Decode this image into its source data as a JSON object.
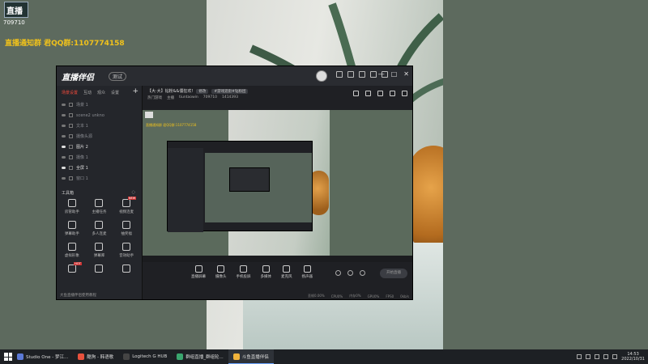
{
  "overlay": {
    "logo_text": "直播",
    "room_id": "709710",
    "notice": "直播通知群 君QQ群:1107774158"
  },
  "app": {
    "brand": "直播伴侣",
    "badge": "测试",
    "window_buttons": [
      "—",
      "□",
      "✕"
    ],
    "left": {
      "tabs": [
        "场景设置",
        "互动",
        "观众",
        "设置"
      ],
      "add_label": "+",
      "scenes": [
        {
          "label": "场景 1",
          "on": false
        },
        {
          "label": "scene2 unkno",
          "on": false
        },
        {
          "label": "文本 1",
          "on": false
        },
        {
          "label": "摄像头源",
          "on": false
        },
        {
          "label": "图片 2",
          "on": true
        },
        {
          "label": "摄像 1",
          "on": false
        },
        {
          "label": "全屏 1",
          "on": true
        },
        {
          "label": "窗口 1",
          "on": false
        }
      ],
      "toolbox_title": "工具箱",
      "tools": [
        {
          "label": "房管助手",
          "hot": ""
        },
        {
          "label": "主播任务",
          "hot": ""
        },
        {
          "label": "视频连麦",
          "hot": "NEW"
        },
        {
          "label": "弹幕助手",
          "hot": ""
        },
        {
          "label": "多人连麦",
          "hot": ""
        },
        {
          "label": "抽奖福",
          "hot": ""
        },
        {
          "label": "虚拟形象",
          "hot": ""
        },
        {
          "label": "弹幕库",
          "hot": ""
        },
        {
          "label": "音效助手",
          "hot": ""
        },
        {
          "label": "",
          "hot": "HOT"
        },
        {
          "label": "",
          "hot": ""
        },
        {
          "label": "",
          "hot": ""
        }
      ],
      "footer": "大鱼直播伴侣使用教程"
    },
    "right": {
      "title": "【大·大】钻粉&&僵狂欢!",
      "pill1": "修改",
      "pill2": "#游戏逛街#钻粉团",
      "meta": [
        "热门游戏",
        "主播",
        "tiuntaowin",
        "709710",
        "1414393"
      ],
      "preview_label": "直播通知群 君QQ群:1107774158",
      "controls": [
        "直播屏幕",
        "摄像头",
        "手机投屏",
        "多媒体",
        "麦克风",
        "扬声器"
      ],
      "live_btn": "开始直播",
      "status": [
        "丢帧0.00%",
        "CPU0%",
        "内存0%",
        "GPU0%",
        "FPS0",
        "0kb/s"
      ]
    }
  },
  "taskbar": {
    "items": [
      {
        "label": "Studio One - 梦江...",
        "color": "#5b79d6"
      },
      {
        "label": "酷狗 - 韩语歌",
        "color": "#e8513d"
      },
      {
        "label": "Logitech G HUB",
        "color": "#444"
      },
      {
        "label": "群组直播_群组轮...",
        "color": "#3aa66e"
      },
      {
        "label": "斗鱼直播伴侣",
        "color": "#f0b33b"
      }
    ],
    "time": "14:53",
    "date": "2022/10/31"
  }
}
